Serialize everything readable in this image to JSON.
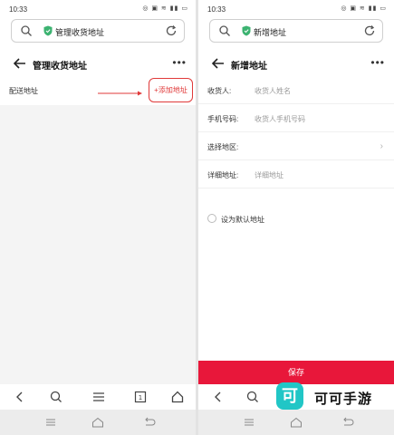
{
  "left": {
    "status": {
      "time": "10:33",
      "icons": "◎ ▣ ≋ ▮▮ ▭"
    },
    "urlbar": {
      "title": "管理收货地址"
    },
    "header": {
      "title": "管理收货地址",
      "more": "•••"
    },
    "address_row_label": "配送地址",
    "add_button": "+添加地址"
  },
  "right": {
    "status": {
      "time": "10:33",
      "icons": "◎ ▣ ≋ ▮▮ ▭"
    },
    "urlbar": {
      "title": "新增地址"
    },
    "header": {
      "title": "新增地址",
      "more": "•••"
    },
    "form": {
      "receiver": {
        "label": "收货人:",
        "placeholder": "收货人姓名"
      },
      "phone": {
        "label": "手机号码:",
        "placeholder": "收货人手机号码"
      },
      "region": {
        "label": "选择地区:",
        "chevron": "›"
      },
      "detail": {
        "label": "详细地址:",
        "placeholder": "详细地址"
      }
    },
    "default_label": "设为默认地址",
    "save_button": "保存"
  },
  "watermark": {
    "logo_char": "可",
    "brand": "可可手游"
  },
  "colors": {
    "accent_red": "#e8173a",
    "shield_green": "#3cb371",
    "watermark_teal": "#21c6c6"
  }
}
